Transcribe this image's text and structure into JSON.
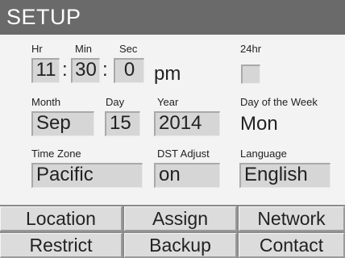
{
  "title": "SETUP",
  "time": {
    "hr_label": "Hr",
    "min_label": "Min",
    "sec_label": "Sec",
    "hr": "11",
    "min": "30",
    "sec": "0",
    "separator": ":",
    "ampm": "pm",
    "format_label": "24hr",
    "format_24hr_checked": false
  },
  "date": {
    "month_label": "Month",
    "day_label": "Day",
    "year_label": "Year",
    "weekday_label": "Day of the Week",
    "month": "Sep",
    "day": "15",
    "year": "2014",
    "weekday": "Mon"
  },
  "zone": {
    "timezone_label": "Time Zone",
    "dst_label": "DST Adjust",
    "language_label": "Language",
    "timezone": "Pacific",
    "dst": "on",
    "language": "English"
  },
  "buttons": {
    "location": "Location",
    "assign": "Assign",
    "network": "Network",
    "restrict": "Restrict",
    "backup": "Backup",
    "contact": "Contact"
  }
}
